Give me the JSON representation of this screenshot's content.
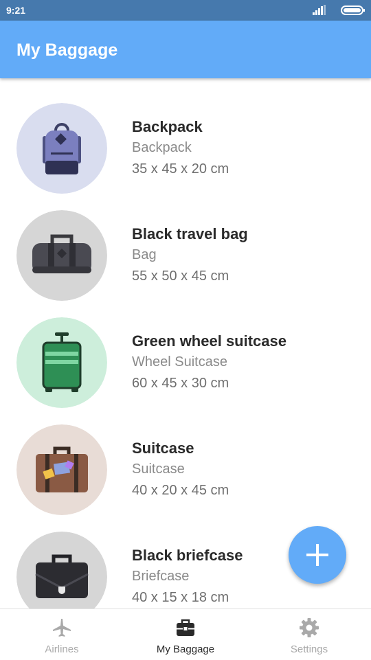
{
  "status_bar": {
    "time": "9:21",
    "icons": [
      "signal-icon",
      "battery-icon"
    ]
  },
  "app_bar": {
    "title": "My Baggage",
    "color": "#62abf8"
  },
  "baggage": [
    {
      "name": "Backpack",
      "type": "Backpack",
      "dimensions": "35 x 45 x 20 cm",
      "icon": "backpack-icon",
      "bg": "#d9ddef"
    },
    {
      "name": "Black travel bag",
      "type": "Bag",
      "dimensions": "55 x 50 x 45 cm",
      "icon": "travel-bag-icon",
      "bg": "#d6d6d6"
    },
    {
      "name": "Green wheel suitcase",
      "type": "Wheel Suitcase",
      "dimensions": "60 x 45 x 30 cm",
      "icon": "wheel-suitcase-icon",
      "bg": "#cdeedb"
    },
    {
      "name": "Suitcase",
      "type": "Suitcase",
      "dimensions": "40 x 20 x 45 cm",
      "icon": "suitcase-icon",
      "bg": "#e8dcd6"
    },
    {
      "name": "Black briefcase",
      "type": "Briefcase",
      "dimensions": "40 x 15 x 18 cm",
      "icon": "briefcase-icon",
      "bg": "#d6d6d6"
    }
  ],
  "fab": {
    "icon": "plus-icon"
  },
  "bottom_nav": [
    {
      "label": "Airlines",
      "icon": "airplane-icon",
      "active": false
    },
    {
      "label": "My Baggage",
      "icon": "baggage-icon",
      "active": true
    },
    {
      "label": "Settings",
      "icon": "gear-icon",
      "active": false
    }
  ]
}
